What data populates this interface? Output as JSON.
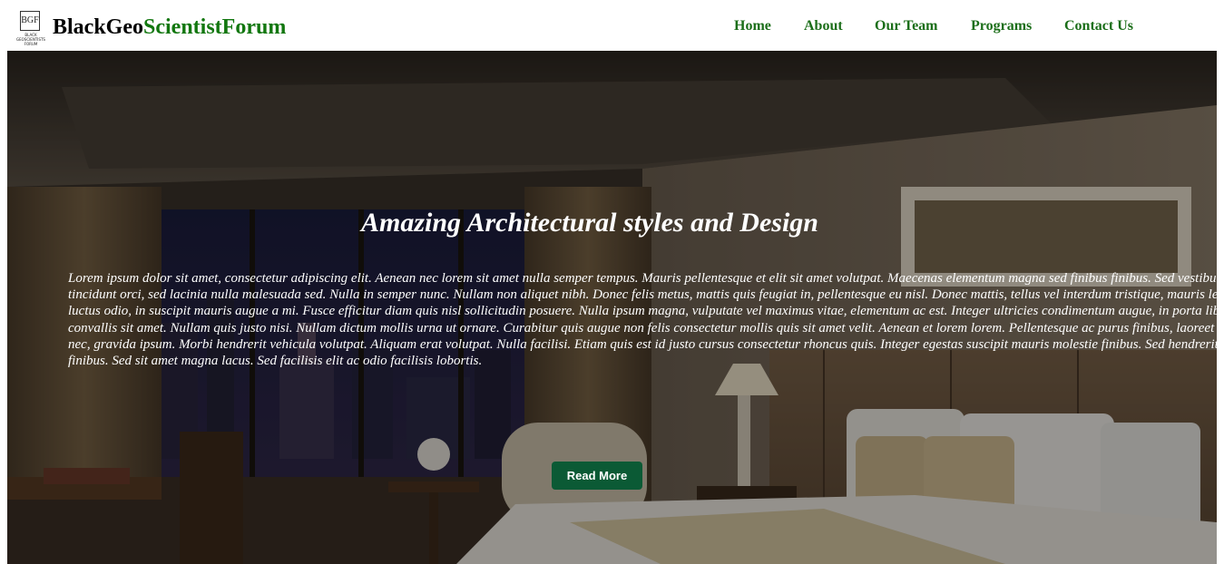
{
  "header": {
    "logo_text": "BGF",
    "logo_caption": "BLACK GEOSCIENTISTS FORUM",
    "brand_part1": "BlackGeo",
    "brand_part2": "ScientistForum",
    "nav": [
      {
        "label": "Home"
      },
      {
        "label": "About"
      },
      {
        "label": "Our Team"
      },
      {
        "label": "Programs"
      },
      {
        "label": "Contact Us"
      }
    ]
  },
  "hero": {
    "title": "Amazing Architectural styles and Design",
    "text": "Lorem ipsum dolor sit amet, consectetur adipiscing elit. Aenean nec lorem sit amet nulla semper tempus. Mauris pellentesque et elit sit amet volutpat. Maecenas elementum magna sed finibus finibus. Sed vestibulum tincidunt orci, sed lacinia nulla malesuada sed. Nulla in semper nunc. Nullam non aliquet nibh. Donec felis metus, mattis quis feugiat in, pellentesque eu nisl. Donec mattis, tellus vel interdum tristique, mauris lectus luctus odio, in suscipit mauris augue a mi. Fusce efficitur diam quis nisl sollicitudin posuere. Nulla ipsum magna, vulputate vel maximus vitae, elementum ac est. Integer ultricies condimentum augue, in porta libero convallis sit amet. Nullam quis justo nisi. Nullam dictum mollis urna ut ornare. Curabitur quis augue non felis consectetur mollis quis sit amet velit. Aenean et lorem lorem. Pellentesque ac purus finibus, laoreet augue nec, gravida ipsum. Morbi hendrerit vehicula volutpat. Aliquam erat volutpat. Nulla facilisi. Etiam quis est id justo cursus consectetur rhoncus quis. Integer egestas suscipit mauris molestie finibus. Sed hendrerit tincidunt finibus. Sed sit amet magna lacus. Sed facilisis elit ac odio facilisis lobortis.",
    "button_label": "Read More"
  },
  "colors": {
    "brand_green": "#12770f",
    "nav_green": "#1b6e19",
    "button_green": "#0b5a35"
  }
}
